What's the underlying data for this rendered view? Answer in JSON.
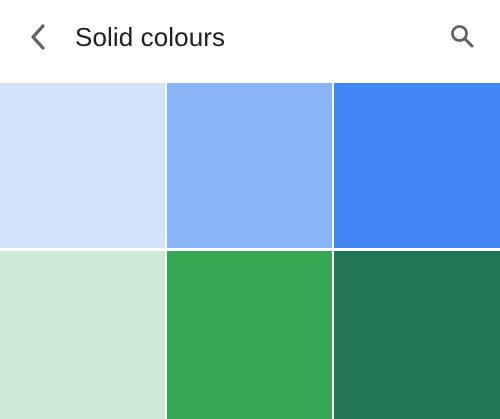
{
  "header": {
    "title": "Solid colours",
    "back_icon": "chevron-left-icon",
    "search_icon": "search-icon"
  },
  "colors": {
    "icon": "#5f6368",
    "title": "#202124"
  },
  "swatches": [
    {
      "color": "#d2e3fc"
    },
    {
      "color": "#8ab4f8"
    },
    {
      "color": "#4285f4"
    },
    {
      "color": "#ceead6"
    },
    {
      "color": "#34a853"
    },
    {
      "color": "#227555"
    }
  ]
}
